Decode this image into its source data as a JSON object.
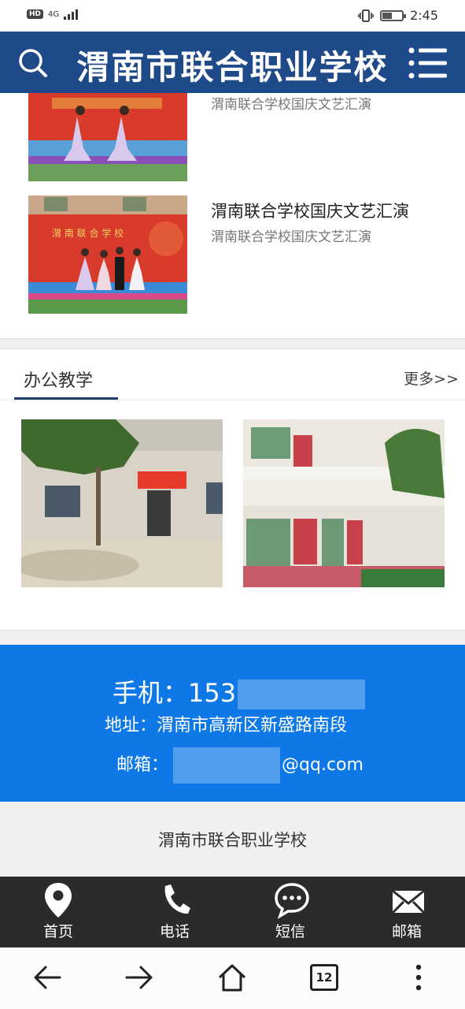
{
  "status_bar": {
    "network_badge": "HD",
    "network_type": "4G",
    "time": "2:45",
    "battery_level": 0.5
  },
  "header": {
    "title": "渭南市联合职业学校",
    "search_icon": "search-icon",
    "menu_icon": "menu-icon"
  },
  "news": [
    {
      "title": "",
      "subtitle": "渭南联合学校国庆文艺汇演"
    },
    {
      "title": "渭南联合学校国庆文艺汇演",
      "subtitle": "渭南联合学校国庆文艺汇演"
    }
  ],
  "section": {
    "title": "办公教学",
    "more": "更多>>"
  },
  "contact": {
    "phone_label": "手机：",
    "phone_visible": "153",
    "address": "地址：渭南市高新区新盛路南段",
    "email_label": "邮箱：",
    "email_suffix": "@qq.com"
  },
  "footer": {
    "school_name": "渭南市联合职业学校"
  },
  "tabbar": [
    {
      "label": "首页",
      "icon": "location-pin-icon"
    },
    {
      "label": "电话",
      "icon": "phone-icon"
    },
    {
      "label": "短信",
      "icon": "message-bubble-icon"
    },
    {
      "label": "邮箱",
      "icon": "envelope-icon"
    }
  ],
  "browser_nav": {
    "tab_count": "12",
    "icons": [
      "back-arrow-icon",
      "forward-arrow-icon",
      "home-icon",
      "tabs-icon",
      "more-vertical-icon"
    ]
  },
  "colors": {
    "header_bg": "#1e4a8a",
    "contact_bg": "#0e78e6",
    "tabbar_bg": "#2b2b2b",
    "footer_bg": "#f0f0f0"
  }
}
